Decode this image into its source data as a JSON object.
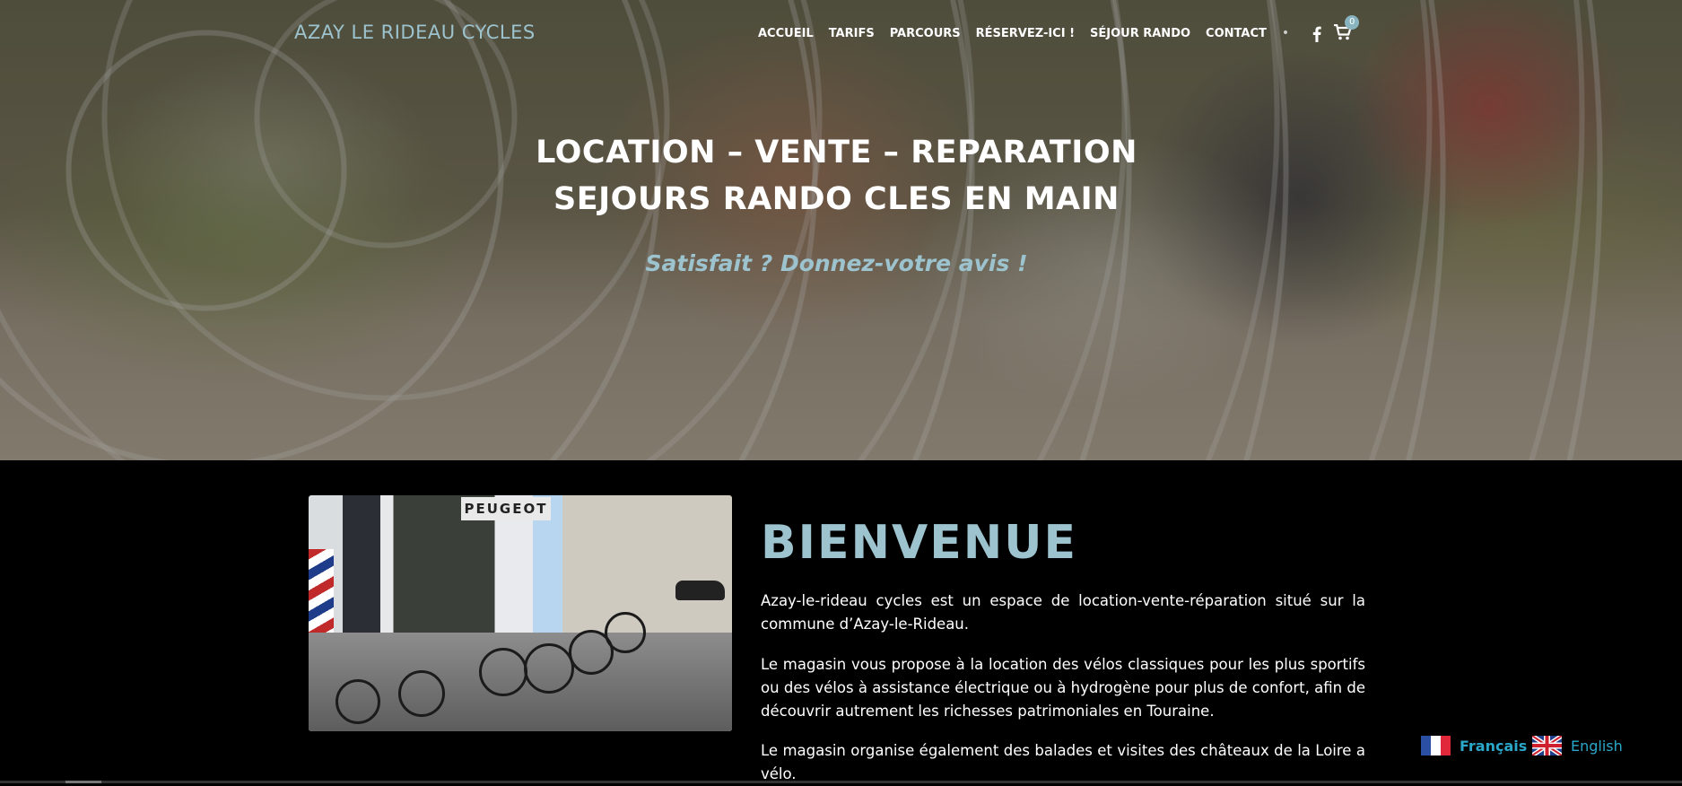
{
  "header": {
    "site_title": "AZAY LE RIDEAU CYCLES",
    "nav": [
      "ACCUEIL",
      "TARIFS",
      "PARCOURS",
      "RÉSERVEZ-ICI !",
      "SÉJOUR RANDO",
      "CONTACT"
    ],
    "separator": "•",
    "social_icon": "facebook-icon",
    "cart_icon": "cart-icon",
    "cart_count": "0"
  },
  "hero": {
    "line1": "LOCATION – VENTE – REPARATION",
    "line2": "SEJOURS RANDO CLES EN MAIN",
    "review_link": "Satisfait ? Donnez-votre avis !"
  },
  "welcome": {
    "title": "BIENVENUE",
    "paragraphs": [
      "Azay-le-rideau cycles est un espace de location-vente-réparation situé sur la commune d’Azay-le-Rideau.",
      "Le magasin vous propose à la location des vélos classiques pour les plus sportifs ou des vélos à assistance électrique ou à hydrogène pour plus de confort, afin de découvrir autrement les richesses patrimoniales en Touraine.",
      "Le magasin organise également des balades et visites des châteaux de la Loire a vélo."
    ],
    "photo_sign": "PEUGEOT"
  },
  "languages": {
    "fr": "Français",
    "en": "English"
  },
  "colors": {
    "accent": "#9cc3ce",
    "language_link": "#2aa7c9",
    "background": "#000000"
  }
}
